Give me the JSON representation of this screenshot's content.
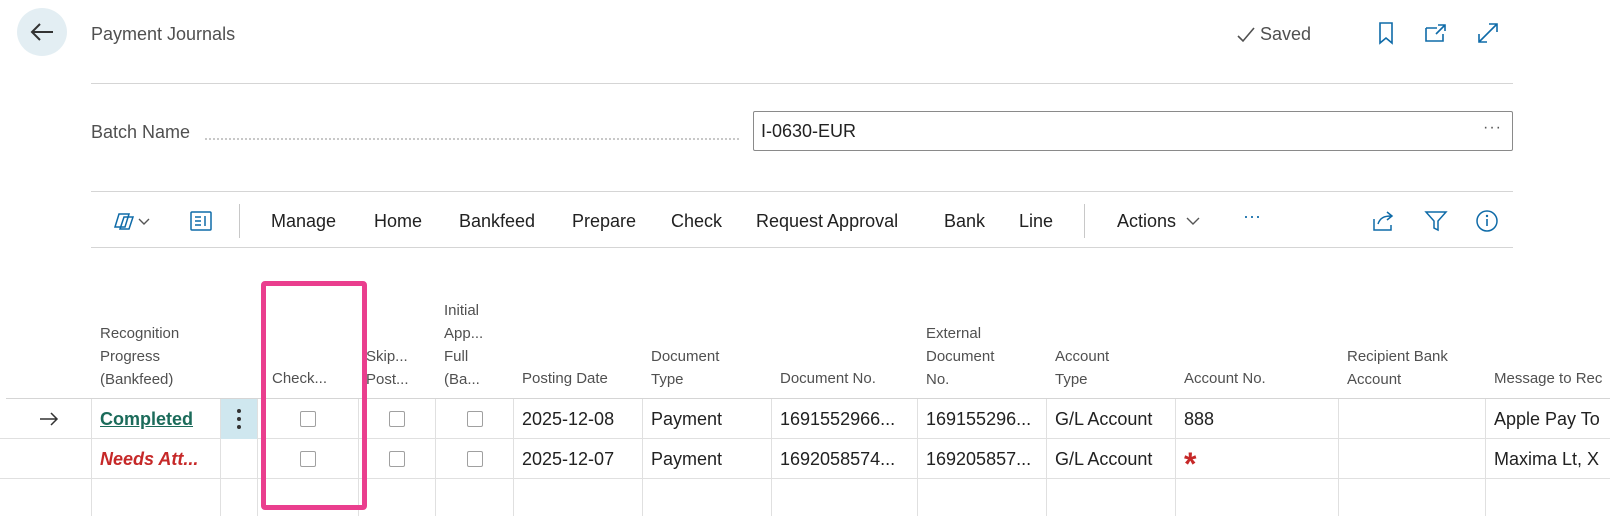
{
  "header": {
    "title": "Payment Journals",
    "saved_label": "Saved"
  },
  "batch": {
    "label": "Batch Name",
    "value": "I-0630-EUR",
    "ellipsis": "···"
  },
  "toolbar": {
    "items": [
      "Manage",
      "Home",
      "Bankfeed",
      "Prepare",
      "Check",
      "Request Approval",
      "Bank",
      "Line"
    ],
    "actions_label": "Actions",
    "more_label": "···"
  },
  "columns": {
    "recognition": [
      "Recognition",
      "Progress",
      "(Bankfeed)"
    ],
    "check": [
      "Check..."
    ],
    "skip": [
      "Skip...",
      "Post..."
    ],
    "initial": [
      "Initial",
      "App...",
      "Full",
      "(Ba..."
    ],
    "posting_date": [
      "Posting Date"
    ],
    "document_type": [
      "Document",
      "Type"
    ],
    "document_no": [
      "Document No."
    ],
    "external_doc": [
      "External",
      "Document",
      "No."
    ],
    "account_type": [
      "Account",
      "Type"
    ],
    "account_no": [
      "Account No."
    ],
    "recipient_bank": [
      "Recipient Bank",
      "Account"
    ],
    "message": [
      "Message to Rec"
    ]
  },
  "rows": [
    {
      "recognition": "Completed",
      "posting_date": "2025-12-08",
      "document_type": "Payment",
      "document_no": "1691552966...",
      "external_doc": "169155296...",
      "account_type": "G/L Account",
      "account_no": "888",
      "message": "Apple Pay To"
    },
    {
      "recognition": "Needs Att...",
      "posting_date": "2025-12-07",
      "document_type": "Payment",
      "document_no": "1692058574...",
      "external_doc": "169205857...",
      "account_type": "G/L Account",
      "account_no": "*",
      "message": "Maxima Lt, X"
    }
  ],
  "colors": {
    "completed": "#1b6b5a",
    "needs_attention": "#c62828",
    "required_marker": "#c62828",
    "highlight": "#ea3e8e",
    "accent": "#0f6ba8"
  }
}
